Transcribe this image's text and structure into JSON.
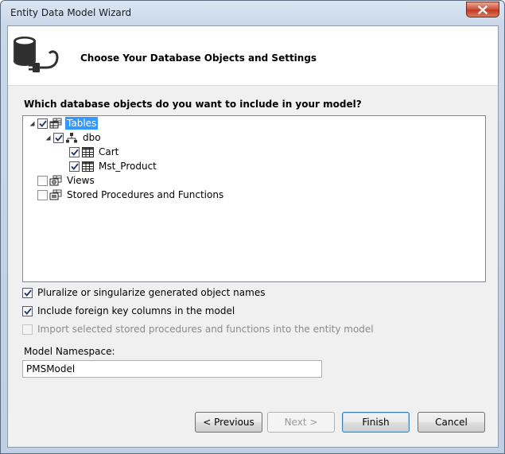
{
  "window": {
    "title": "Entity Data Model Wizard"
  },
  "header": {
    "title": "Choose Your Database Objects and Settings",
    "icon": "database-plug-icon"
  },
  "main": {
    "question": "Which database objects do you want to include in your model?",
    "tree": [
      {
        "label": "Tables",
        "checked": true,
        "expanded": true,
        "selected": true,
        "icon": "tables-icon",
        "level": 0
      },
      {
        "label": "dbo",
        "checked": true,
        "expanded": true,
        "selected": false,
        "icon": "schema-icon",
        "level": 1
      },
      {
        "label": "Cart",
        "checked": true,
        "selected": false,
        "icon": "table-icon",
        "level": 2
      },
      {
        "label": "Mst_Product",
        "checked": true,
        "selected": false,
        "icon": "table-icon",
        "level": 2
      },
      {
        "label": "Views",
        "checked": false,
        "selected": false,
        "icon": "views-icon",
        "level": 0
      },
      {
        "label": "Stored Procedures and Functions",
        "checked": false,
        "selected": false,
        "icon": "procedures-icon",
        "level": 0
      }
    ],
    "options": {
      "pluralize": {
        "label": "Pluralize or singularize generated object names",
        "checked": true,
        "enabled": true
      },
      "foreign_keys": {
        "label": "Include foreign key columns in the model",
        "checked": true,
        "enabled": true
      },
      "import_procs": {
        "label": "Import selected stored procedures and functions into the entity model",
        "checked": false,
        "enabled": false
      }
    },
    "namespace": {
      "label": "Model Namespace:",
      "value": "PMSModel"
    }
  },
  "footer": {
    "previous_label": "< Previous",
    "next_label": "Next >",
    "finish_label": "Finish",
    "cancel_label": "Cancel"
  },
  "colors": {
    "selection": "#3399ff",
    "client_bg": "#f0f0f0",
    "close_button": "#c23a22"
  }
}
